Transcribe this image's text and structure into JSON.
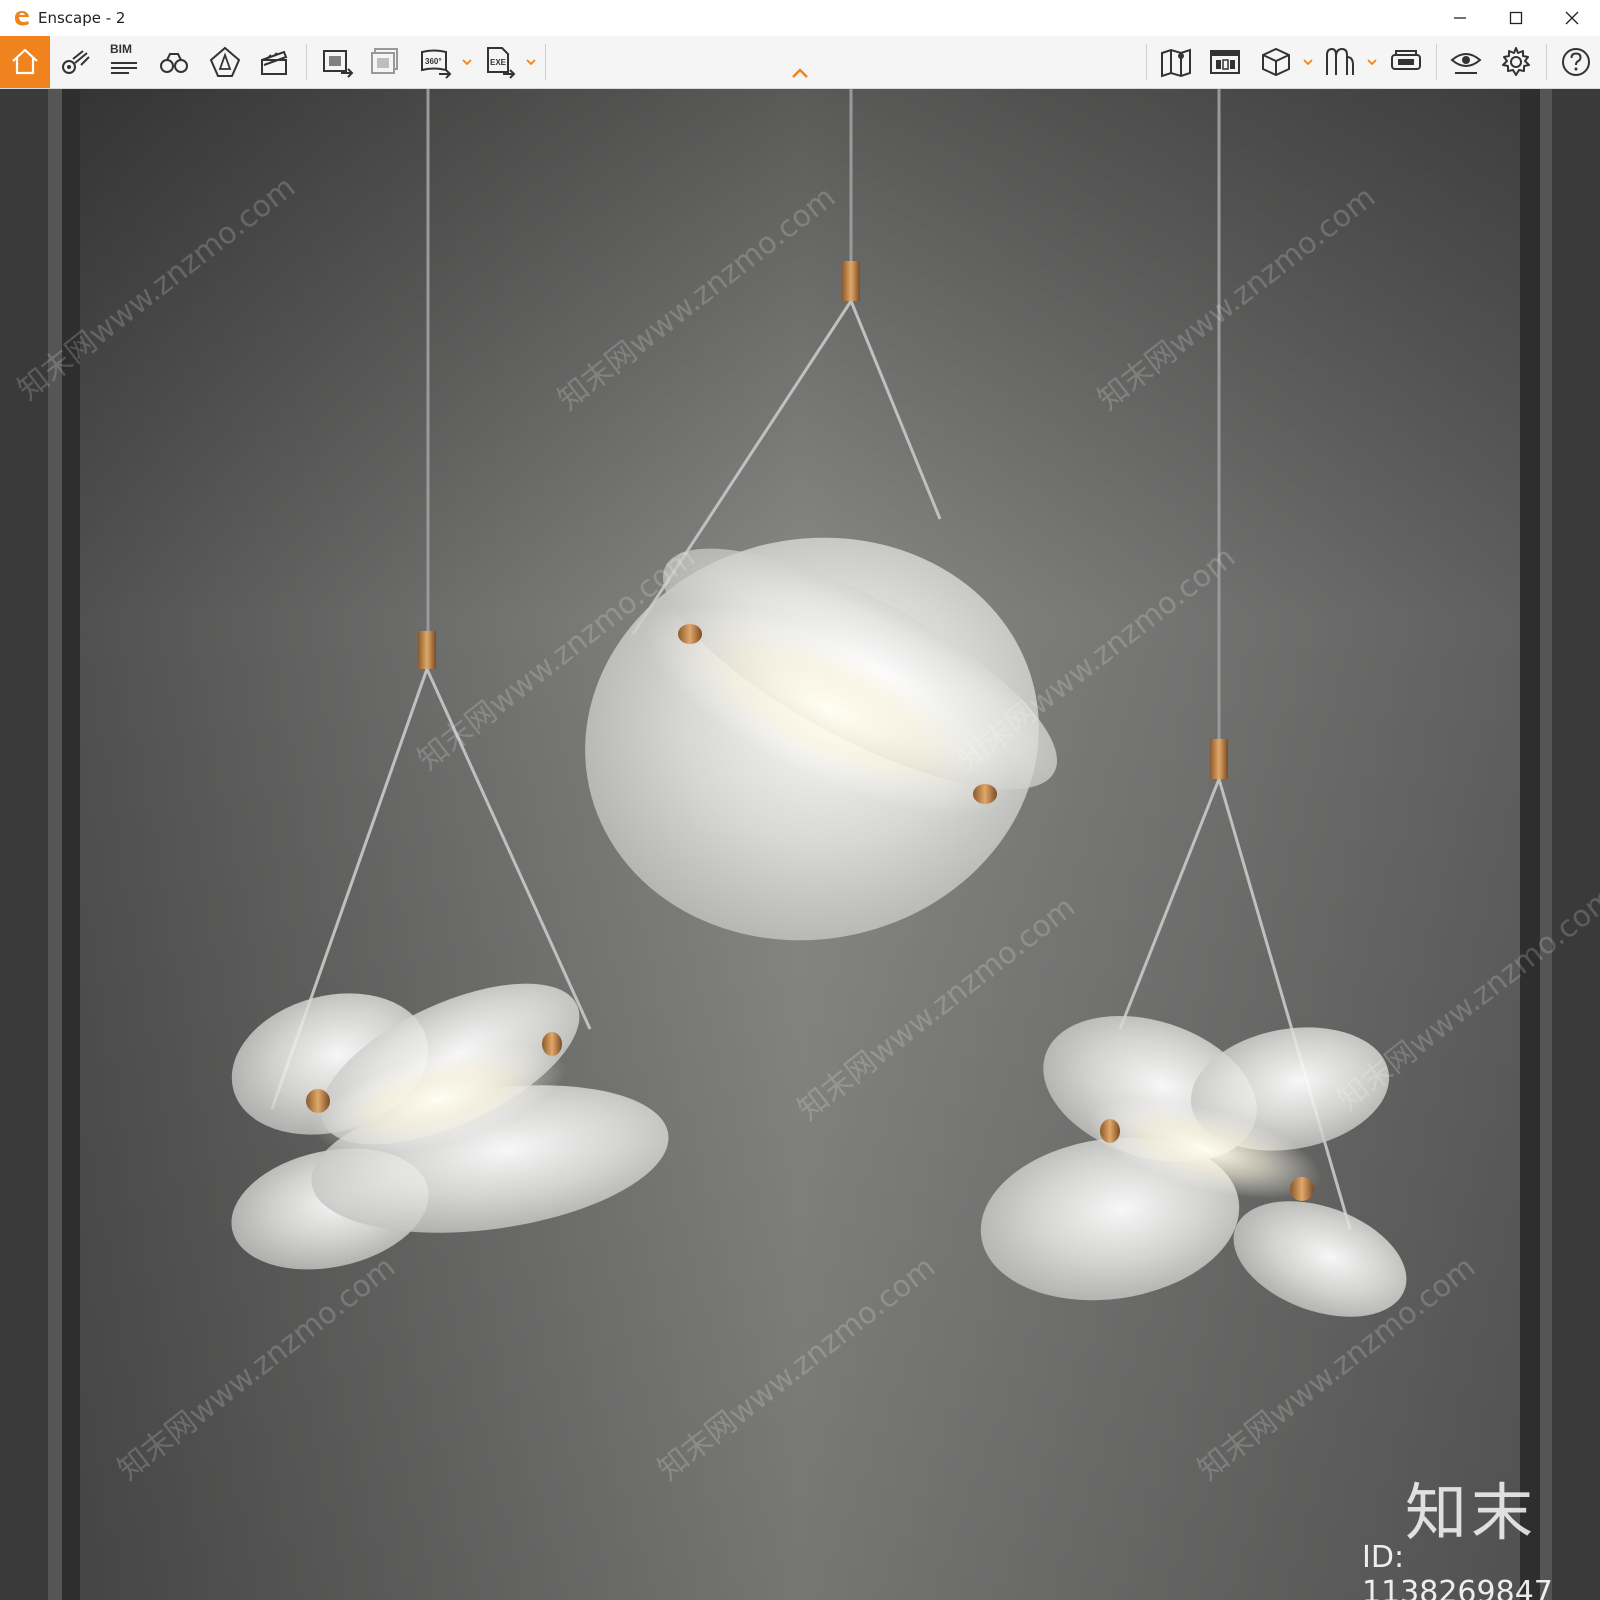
{
  "window": {
    "title": "Enscape - 2",
    "accent_color": "#f0831e"
  },
  "toolbar": {
    "bim_label": "BIM",
    "icons_left": [
      "home-icon",
      "views-icon",
      "bim-icon",
      "binoculars-icon",
      "perspective-icon",
      "video-editor-icon",
      "render-screenshot-icon",
      "batch-render-icon",
      "panorama-360-icon",
      "export-exe-icon"
    ],
    "icons_right": [
      "map-icon",
      "asset-library-icon",
      "material-editor-icon",
      "sketch-icon",
      "vr-headset-icon",
      "visual-settings-icon",
      "settings-icon",
      "help-icon"
    ],
    "panorama_label": "360°",
    "exe_label": "EXE"
  },
  "viewport": {
    "watermark_text": "知末网www.znzmo.com",
    "brand_mark": "知末",
    "image_id": "ID: 1138269847"
  }
}
